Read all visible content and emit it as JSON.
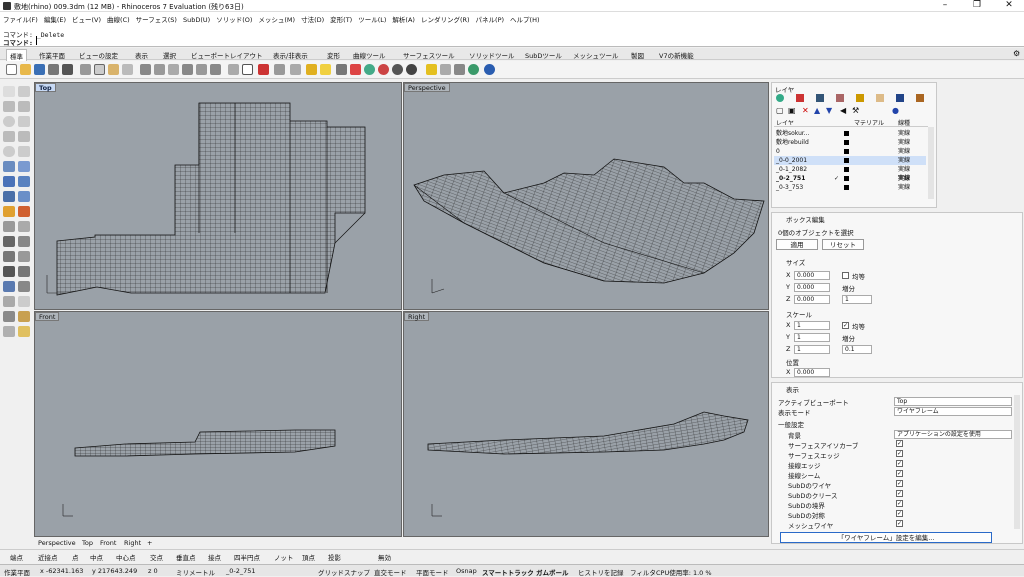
{
  "window": {
    "title": "敷地(rhino) 009.3dm (12 MB) - Rhinoceros 7 Evaluation (残り63日)",
    "minimize": "–",
    "maximize": "❐",
    "close": "✕"
  },
  "menu": [
    "ファイル(F)",
    "編集(E)",
    "ビュー(V)",
    "曲線(C)",
    "サーフェス(S)",
    "SubD(U)",
    "ソリッド(O)",
    "メッシュ(M)",
    "寸法(D)",
    "変形(T)",
    "ツール(L)",
    "解析(A)",
    "レンダリング(R)",
    "パネル(P)",
    "ヘルプ(H)"
  ],
  "command": {
    "history1": "コマンド: _Delete",
    "prompt": "コマンド:",
    "value": ""
  },
  "toolbar_tabs": [
    "標準",
    "作業平面",
    "ビューの設定",
    "表示",
    "選択",
    "ビューポートレイアウト",
    "表示/非表示",
    "変形",
    "曲線ツール",
    "サーフェスツール",
    "ソリッドツール",
    "SubDツール",
    "メッシュツール",
    "製図",
    "V7の新機能"
  ],
  "viewports": {
    "top": "Top",
    "perspective": "Perspective",
    "front": "Front",
    "right": "Right",
    "axis_x": "x",
    "axis_y": "y",
    "axis_z": "z"
  },
  "viewport_tabs": [
    "Perspective",
    "Top",
    "Front",
    "Right",
    "+"
  ],
  "osnaps": [
    "端点",
    "近接点",
    "点",
    "中点",
    "中心点",
    "交点",
    "垂直点",
    "接点",
    "四半円点",
    "ノット",
    "頂点",
    "投影"
  ],
  "osnap_disable": "無効",
  "status": {
    "cplane": "作業平面",
    "x": "x -62341.163",
    "y": "y 217643.249",
    "z": "z 0",
    "units": "ミリメートル",
    "layer": "_0-2_751",
    "grid_snap": "グリッドスナップ",
    "ortho": "直交モード",
    "planar": "平面モード",
    "osnap": "Osnap",
    "smarttrack": "スマートトラック",
    "gumball": "ガムボール",
    "history": "ヒストリを記録",
    "filter": "フィルタ",
    "cpu": "CPU使用率: 1.0 %"
  },
  "layers_panel": {
    "title": "レイヤ",
    "col_layer": "レイヤ",
    "col_material": "マテリアル",
    "col_linetype": "線種",
    "rows": [
      {
        "name": "敷地sokur...",
        "linetype": "実線"
      },
      {
        "name": "敷地rebuild",
        "linetype": "実線"
      },
      {
        "name": "0",
        "linetype": "実線"
      },
      {
        "name": "_0-0_2001",
        "linetype": "実線",
        "selected": true
      },
      {
        "name": "_0-1_2082",
        "linetype": "実線"
      },
      {
        "name": "_0-2_751",
        "linetype": "実線",
        "current": true
      },
      {
        "name": "_0-3_753",
        "linetype": "実線"
      }
    ]
  },
  "box_edit": {
    "title": "ボックス編集",
    "selection": "0個のオブジェクトを選択",
    "apply": "適用",
    "reset": "リセット",
    "size_label": "サイズ",
    "scale_label": "スケール",
    "position_label": "位置",
    "uniform": "均等",
    "increment": "増分",
    "size": {
      "x": "0.000",
      "y": "0.000",
      "z": "0.000",
      "inc": "1"
    },
    "scale": {
      "x": "1",
      "y": "1",
      "z": "1",
      "inc": "0.1"
    },
    "position": {
      "x": "0.000"
    }
  },
  "display_panel": {
    "title": "表示",
    "active_vp_label": "アクティブビューポート",
    "active_vp": "Top",
    "mode_label": "表示モード",
    "mode": "ワイヤフレーム",
    "general": "一般設定",
    "bg_label": "背景",
    "bg": "アプリケーションの設定を使用",
    "items": [
      "サーフェスアイソカーブ",
      "サーフェスエッジ",
      "接線エッジ",
      "接線シーム",
      "SubDのワイヤ",
      "SubDのクリース",
      "SubDの境界",
      "SubDの対称",
      "メッシュワイヤ"
    ],
    "edit_button": "「ワイヤフレーム」設定を編集..."
  }
}
